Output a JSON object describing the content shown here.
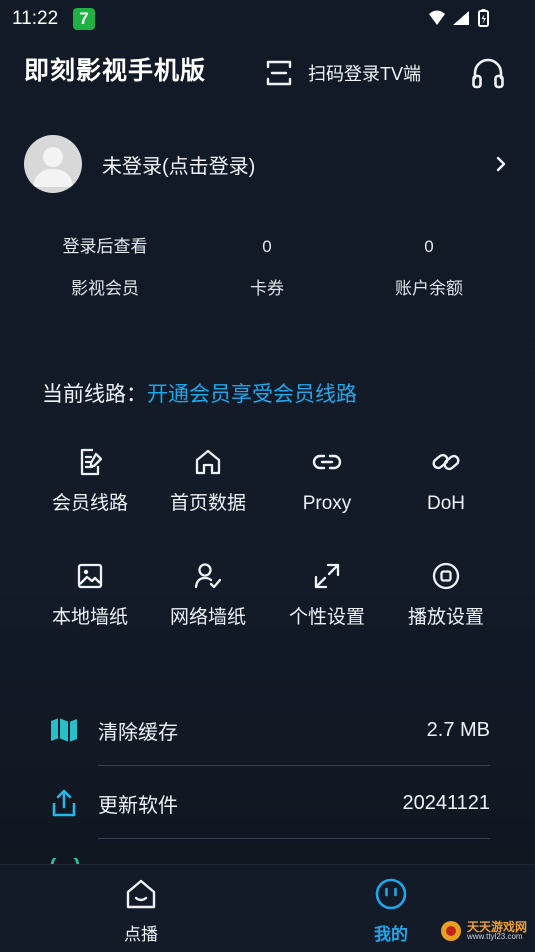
{
  "status_bar": {
    "time": "11:22",
    "app_badge": "7"
  },
  "header": {
    "title": "即刻影视手机版",
    "scan_label": "扫码登录TV端"
  },
  "profile": {
    "login_text": "未登录(点击登录)"
  },
  "stats": [
    {
      "value": "登录后查看",
      "label": "影视会员"
    },
    {
      "value": "0",
      "label": "卡券"
    },
    {
      "value": "0",
      "label": "账户余额"
    }
  ],
  "route": {
    "label": "当前线路：",
    "link": "开通会员享受会员线路"
  },
  "grid": [
    {
      "label": "会员线路",
      "icon": "edit-document-icon"
    },
    {
      "label": "首页数据",
      "icon": "home-icon"
    },
    {
      "label": "Proxy",
      "icon": "link-icon"
    },
    {
      "label": "DoH",
      "icon": "chain-link-icon"
    },
    {
      "label": "本地墙纸",
      "icon": "image-icon"
    },
    {
      "label": "网络墙纸",
      "icon": "user-check-icon"
    },
    {
      "label": "个性设置",
      "icon": "expand-icon"
    },
    {
      "label": "播放设置",
      "icon": "stop-circle-icon"
    }
  ],
  "list": [
    {
      "label": "清除缓存",
      "value": "2.7 MB",
      "icon": "map-icon"
    },
    {
      "label": "更新软件",
      "value": "20241121",
      "icon": "share-upload-icon"
    }
  ],
  "bottom_nav": [
    {
      "label": "点播",
      "icon": "home-icon"
    },
    {
      "label": "我的",
      "icon": "smile-icon"
    }
  ],
  "colors": {
    "accent": "#1ea7e9",
    "teal": "#28c0c8",
    "background": "#131a28"
  },
  "watermark": {
    "text": "天天游戏网",
    "url_text": "www.ttyl23.com"
  }
}
